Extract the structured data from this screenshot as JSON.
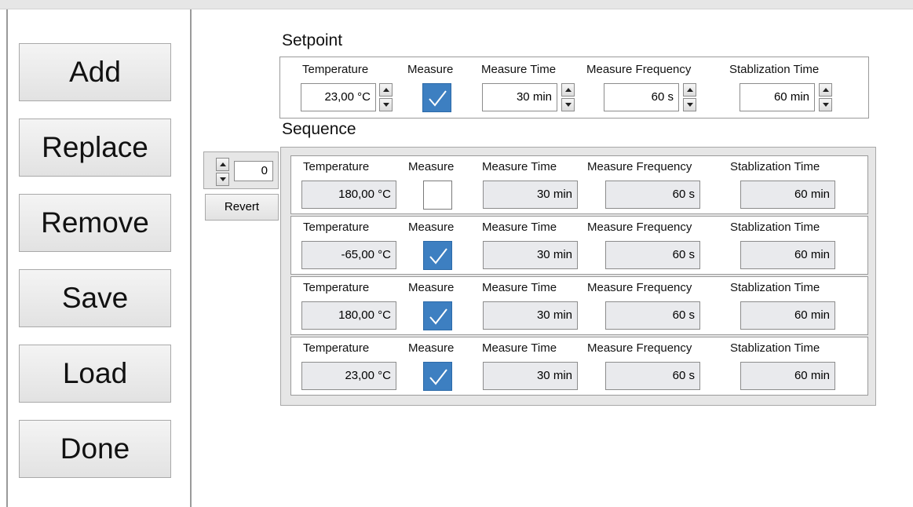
{
  "buttons": {
    "add": "Add",
    "replace": "Replace",
    "remove": "Remove",
    "save": "Save",
    "load": "Load",
    "done": "Done",
    "revert": "Revert"
  },
  "setpoint": {
    "title": "Setpoint",
    "labels": {
      "temperature": "Temperature",
      "measure": "Measure",
      "measure_time": "Measure Time",
      "measure_frequency": "Measure Frequency",
      "stabilization_time": "Stablization Time"
    },
    "temperature": "23,00 °C",
    "measure_checked": true,
    "measure_time": "30 min",
    "measure_frequency": "60 s",
    "stabilization_time": "60 min"
  },
  "sequence": {
    "title": "Sequence",
    "index": "0",
    "labels": {
      "temperature": "Temperature",
      "measure": "Measure",
      "measure_time": "Measure Time",
      "measure_frequency": "Measure Frequency",
      "stabilization_time": "Stablization Time"
    },
    "rows": [
      {
        "temperature": "180,00 °C",
        "measure_checked": false,
        "measure_time": "30 min",
        "measure_frequency": "60 s",
        "stabilization_time": "60 min"
      },
      {
        "temperature": "-65,00 °C",
        "measure_checked": true,
        "measure_time": "30 min",
        "measure_frequency": "60 s",
        "stabilization_time": "60 min"
      },
      {
        "temperature": "180,00 °C",
        "measure_checked": true,
        "measure_time": "30 min",
        "measure_frequency": "60 s",
        "stabilization_time": "60 min"
      },
      {
        "temperature": "23,00 °C",
        "measure_checked": true,
        "measure_time": "30 min",
        "measure_frequency": "60 s",
        "stabilization_time": "60 min"
      }
    ]
  },
  "colors": {
    "checkbox_checked": "#3d7fc1",
    "readonly_field": "#e9eaed",
    "panel_background": "#e6e6e6"
  },
  "icons": {
    "checkmark": "check-icon",
    "spin_up": "arrow-up-icon",
    "spin_down": "arrow-down-icon"
  }
}
